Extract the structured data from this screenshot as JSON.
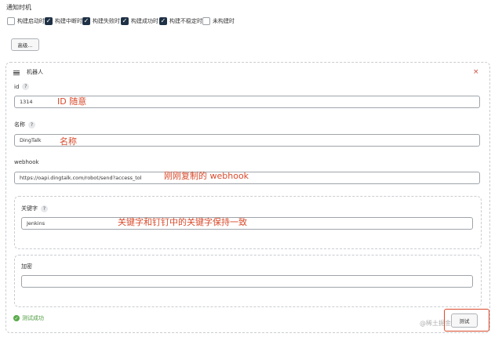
{
  "notify": {
    "title": "通知时机",
    "options": [
      {
        "label": "构建启动时",
        "checked": false
      },
      {
        "label": "构建中断时",
        "checked": true
      },
      {
        "label": "构建失败时",
        "checked": true
      },
      {
        "label": "构建成功时",
        "checked": true
      },
      {
        "label": "构建不稳定时",
        "checked": true
      },
      {
        "label": "未构建时",
        "checked": false
      }
    ],
    "advanced_label": "高级..."
  },
  "robot": {
    "title": "机器人",
    "close_icon": "×",
    "id_label": "id",
    "id_value": "1314",
    "name_label": "名称",
    "name_value": "DingTalk",
    "webhook_label": "webhook",
    "webhook_value": "https://oapi.dingtalk.com/robot/send?access_toke",
    "keyword_label": "关键字",
    "keyword_value": "Jenkins",
    "sign_label": "加密",
    "sign_value": "",
    "help_icon": "?",
    "status_text": "测试成功",
    "test_label": "测试"
  },
  "annotations": {
    "id_note": "ID 随意",
    "name_note": "名称",
    "webhook_note": "刚刚复制的 webhook",
    "keyword_note": "关键字和钉钉中的关键字保持一致"
  },
  "watermark": "@稀土掘金技术社区",
  "colors": {
    "checkbox_on": "#1f3145",
    "annotation": "#d94a2b",
    "success": "#4a9a3c"
  },
  "icons": [
    "check-icon",
    "hamburger-icon",
    "close-icon",
    "help-icon",
    "success-icon"
  ]
}
